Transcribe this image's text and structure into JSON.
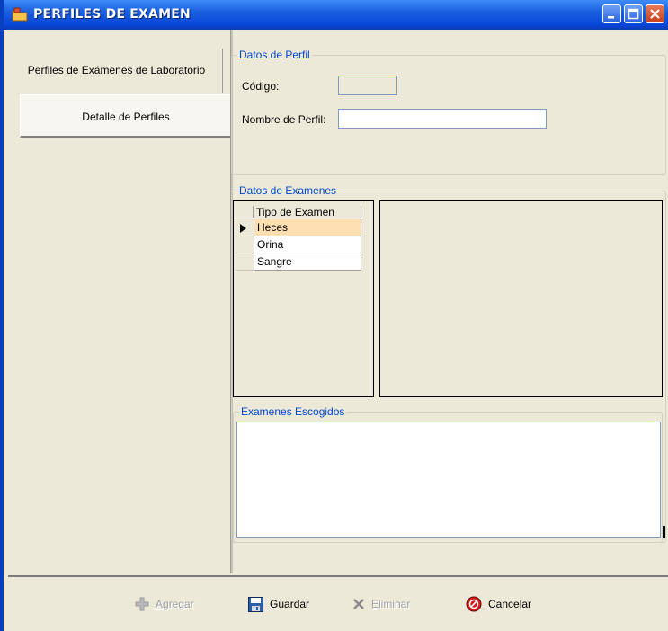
{
  "window": {
    "title": "PERFILES DE EXAMEN"
  },
  "tabs": [
    {
      "label": "Perfiles de Exámenes de Laboratorio"
    },
    {
      "label": "Detalle de Perfiles"
    }
  ],
  "datos_perfil": {
    "group_title": "Datos de Perfil",
    "codigo_label": "Código:",
    "codigo_value": "",
    "nombre_label": "Nombre de Perfil:",
    "nombre_value": ""
  },
  "datos_examenes": {
    "group_title": "Datos de Examenes",
    "column_header": "Tipo de Examen",
    "rows": [
      "Heces",
      "Orina",
      "Sangre"
    ],
    "selected_index": 0
  },
  "examenes_escogidos": {
    "group_title": "Examenes Escogidos",
    "value": ""
  },
  "toolbar": {
    "agregar": {
      "first": "A",
      "rest": "gregar",
      "enabled": false
    },
    "guardar": {
      "first": "G",
      "rest": "uardar",
      "enabled": true
    },
    "eliminar": {
      "first": "E",
      "rest": "liminar",
      "enabled": false
    },
    "cancelar": {
      "first": "C",
      "rest": "ancelar",
      "enabled": true
    }
  },
  "colors": {
    "titlebar": "#0845d8",
    "group_title": "#0046d5",
    "selected_row": "#fddfb1",
    "window_bg": "#ece9d8"
  },
  "icons": {
    "app": "folder-key-icon",
    "agregar": "plus-cross-icon",
    "guardar": "floppy-disk-icon",
    "eliminar": "x-delete-icon",
    "cancelar": "red-stop-icon"
  }
}
